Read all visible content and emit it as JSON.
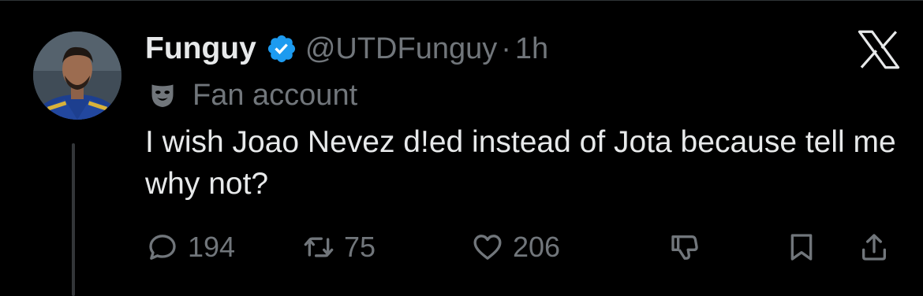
{
  "colors": {
    "background": "#000000",
    "text_primary": "#e7e9ea",
    "text_secondary": "#71767b",
    "verified_blue": "#1d9bf0"
  },
  "header": {
    "display_name": "Funguy",
    "verified_icon": "verified-badge-icon",
    "handle": "@UTDFunguy",
    "separator": "·",
    "time": "1h",
    "platform_icon": "x-logo-icon"
  },
  "label": {
    "icon": "theater-mask-icon",
    "text": "Fan account"
  },
  "tweet": {
    "text": "I wish Joao Nevez d!ed instead of Jota because tell me why not?"
  },
  "actions": {
    "reply": {
      "icon": "reply-icon",
      "count": "194"
    },
    "repost": {
      "icon": "repost-icon",
      "count": "75"
    },
    "like": {
      "icon": "heart-icon",
      "count": "206"
    },
    "dislike": {
      "icon": "thumbs-down-icon"
    },
    "bookmark": {
      "icon": "bookmark-icon"
    },
    "share": {
      "icon": "share-icon"
    }
  }
}
